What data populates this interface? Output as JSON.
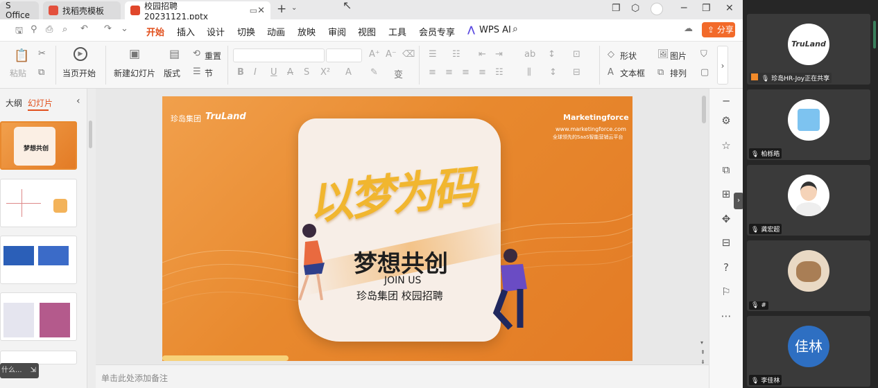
{
  "tabs": [
    {
      "label": "S Office"
    },
    {
      "label": "找稻壳模板"
    },
    {
      "label": "校园招聘20231121.pptx"
    }
  ],
  "menu": [
    "开始",
    "插入",
    "设计",
    "切换",
    "动画",
    "放映",
    "审阅",
    "视图",
    "工具",
    "会员专享"
  ],
  "menu_ai": "WPS AI",
  "share_label": "分享",
  "ribbon": {
    "paste": "粘贴",
    "from_current": "当页开始",
    "new_slide": "新建幻灯片",
    "layout": "版式",
    "reset": "重置",
    "section": "节",
    "shape": "形状",
    "image": "图片",
    "textbox": "文本框",
    "arrange": "排列"
  },
  "left_panel": {
    "outline": "大纲",
    "slides": "幻灯片",
    "search_placeholder": "什么..."
  },
  "slide": {
    "brand_left": "珍岛集团",
    "brand_logo": "TruLand",
    "brand_right": "Marketingforce",
    "website": "www.marketingforce.com",
    "slogan_small": "全球领先的SaaS智能营销云平台",
    "calligraphy": "以梦为码",
    "title": "梦想共创",
    "subtitle": "JOIN US",
    "tagline": "珍岛集团 校园招聘"
  },
  "notes_placeholder": "单击此处添加备注",
  "meeting": {
    "participants": [
      {
        "name": "珍岛HR-Joy正在共享",
        "avatar": "TruLand"
      },
      {
        "name": "柏栎皓",
        "avatar": ""
      },
      {
        "name": "龚宏超",
        "avatar": ""
      },
      {
        "name": "#",
        "avatar": ""
      },
      {
        "name": "李佳林",
        "avatar": "佳林"
      }
    ]
  },
  "colors": {
    "accent": "#e14f1c",
    "slide_orange": "#e8892e",
    "meeting_bg": "#262626"
  }
}
